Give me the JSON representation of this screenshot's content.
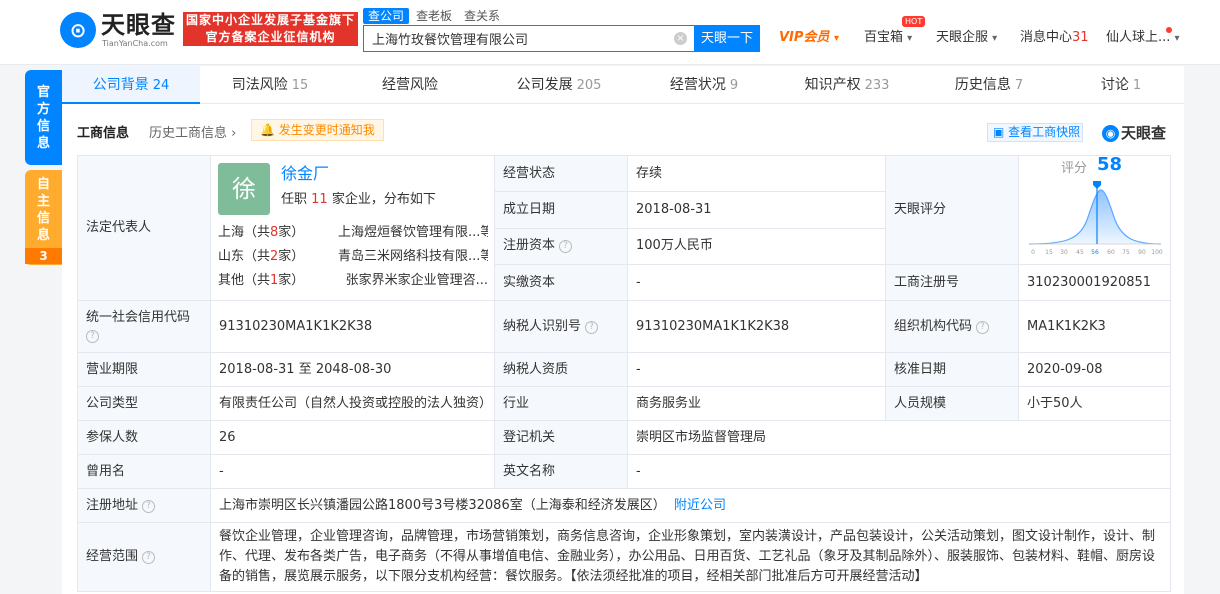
{
  "header": {
    "logo_glyph": "⊙",
    "logo_name": "天眼查",
    "logo_en": "TianYanCha.com",
    "badge_line1": "国家中小企业发展子基金旗下",
    "badge_line2": "官方备案企业征信机构",
    "search_tabs": [
      "查公司",
      "查老板",
      "查关系"
    ],
    "search_value": "上海竹玫餐饮管理有限公司",
    "search_button": "天眼一下",
    "vip": "VIP会员",
    "treasure": "百宝箱",
    "hot": "HOT",
    "public": "天眼企服",
    "messages": "消息中心",
    "messages_count": "31",
    "user": "仙人球上..."
  },
  "side_tabs": {
    "official": "官方信息",
    "self": "自主信息",
    "self_count": "3"
  },
  "tabs": [
    {
      "label": "公司背景",
      "count": "24"
    },
    {
      "label": "司法风险",
      "count": "15"
    },
    {
      "label": "经营风险",
      "count": ""
    },
    {
      "label": "公司发展",
      "count": "205"
    },
    {
      "label": "经营状况",
      "count": "9"
    },
    {
      "label": "知识产权",
      "count": "233"
    },
    {
      "label": "历史信息",
      "count": "7"
    },
    {
      "label": "讨论",
      "count": "1"
    }
  ],
  "section": {
    "title": "工商信息",
    "history": "历史工商信息",
    "notify": "发生变更时通知我",
    "snapshot": "查看工商快照",
    "brand": "天眼查"
  },
  "info": {
    "legal_rep_label": "法定代表人",
    "rep_avatar": "徐",
    "rep_name": "徐金厂",
    "rep_pre": "任职",
    "rep_count": "11",
    "rep_post": "家企业，分布如下",
    "regions": [
      {
        "pre": "上海（共",
        "n": "8",
        "post": "家）",
        "company": "上海煜烜餐饮管理有限...等"
      },
      {
        "pre": "山东（共",
        "n": "2",
        "post": "家）",
        "company": "青岛三米网络科技有限...等"
      },
      {
        "pre": "其他（共",
        "n": "1",
        "post": "家）",
        "company": "张家界米家企业管理咨..."
      }
    ],
    "status_label": "经营状态",
    "status": "存续",
    "founded_label": "成立日期",
    "founded": "2018-08-31",
    "capital_label": "注册资本",
    "capital": "100万人民币",
    "paid_label": "实缴资本",
    "paid": "-",
    "score_label": "天眼评分",
    "score_word": "评分",
    "score": "58",
    "score_ticks": [
      "0",
      "15",
      "30",
      "45",
      "56",
      "60",
      "75",
      "90",
      "100"
    ],
    "regno_label": "工商注册号",
    "regno": "310230001920851",
    "credit_label": "统一社会信用代码",
    "credit": "91310230MA1K1K2K38",
    "taxid_label": "纳税人识别号",
    "taxid": "91310230MA1K1K2K38",
    "orgcode_label": "组织机构代码",
    "orgcode": "MA1K1K2K3",
    "term_label": "营业期限",
    "term": "2018-08-31  至 2048-08-30",
    "taxqual_label": "纳税人资质",
    "taxqual": "-",
    "approve_label": "核准日期",
    "approve": "2020-09-08",
    "type_label": "公司类型",
    "type": "有限责任公司（自然人投资或控股的法人独资）",
    "industry_label": "行业",
    "industry": "商务服务业",
    "staff_label": "人员规模",
    "staff": "小于50人",
    "insured_label": "参保人数",
    "insured": "26",
    "authority_label": "登记机关",
    "authority": "崇明区市场监督管理局",
    "former_label": "曾用名",
    "former": "-",
    "en_label": "英文名称",
    "en": "-",
    "addr_label": "注册地址",
    "addr": "上海市崇明区长兴镇潘园公路1800号3号楼32086室（上海泰和经济发展区）",
    "nearby": "附近公司",
    "scope_label": "经营范围",
    "scope": "餐饮企业管理，企业管理咨询，品牌管理，市场营销策划，商务信息咨询，企业形象策划，室内装潢设计，产品包装设计，公关活动策划，图文设计制作，设计、制作、代理、发布各类广告，电子商务（不得从事增值电信、金融业务），办公用品、日用百货、工艺礼品（象牙及其制品除外）、服装服饰、包装材料、鞋帽、厨房设备的销售，展览展示服务，以下限分支机构经营：餐饮服务。【依法须经批准的项目，经相关部门批准后方可开展经营活动】"
  }
}
